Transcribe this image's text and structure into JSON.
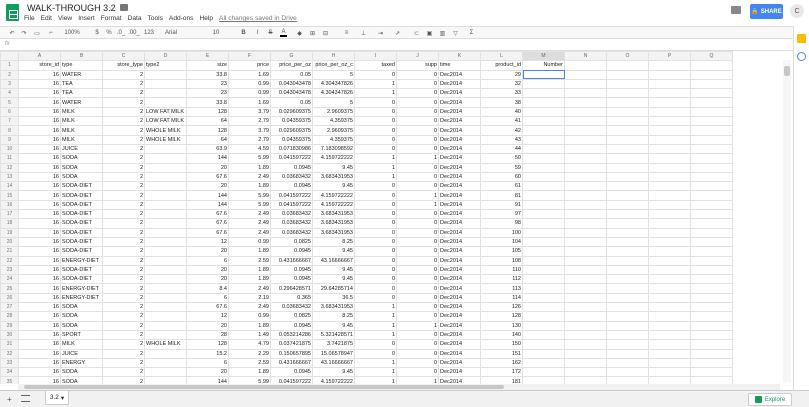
{
  "app": {
    "title": "WALK-THROUGH 3.2",
    "saved_status": "All changes saved in Drive",
    "share_label": "SHARE",
    "avatar_initial": "C"
  },
  "menu": [
    "File",
    "Edit",
    "View",
    "Insert",
    "Format",
    "Data",
    "Tools",
    "Add-ons",
    "Help"
  ],
  "toolbar": {
    "zoom": "100%",
    "currency": "$",
    "percent": "%",
    "decrease_decimals": ".0_",
    "increase_decimals": ".00_",
    "number_format": "123",
    "font": "Arial",
    "font_size": "10"
  },
  "formula_bar": {
    "fx": "fx",
    "value": ""
  },
  "column_letters": [
    "A",
    "B",
    "C",
    "D",
    "E",
    "F",
    "G",
    "H",
    "I",
    "J",
    "K",
    "L",
    "M",
    "N",
    "O",
    "P",
    "Q"
  ],
  "headers": [
    "store_id",
    "type",
    "store_type",
    "type2",
    "size",
    "price",
    "price_per_oz",
    "price_per_oz_c",
    "taxed",
    "supp",
    "time",
    "product_id",
    "Number",
    "",
    "",
    "",
    ""
  ],
  "rows": [
    [
      "16",
      "WATER",
      "2",
      "",
      "33.8",
      "1.69",
      "0.05",
      "5",
      "0",
      "0",
      "Dec2014",
      "29"
    ],
    [
      "16",
      "TEA",
      "2",
      "",
      "23",
      "0.99",
      "0.043043478",
      "4.304347826",
      "1",
      "0",
      "Dec2014",
      "32"
    ],
    [
      "16",
      "TEA",
      "2",
      "",
      "23",
      "0.99",
      "0.043043478",
      "4.304347826",
      "1",
      "0",
      "Dec2014",
      "33"
    ],
    [
      "16",
      "WATER",
      "2",
      "",
      "33.8",
      "1.69",
      "0.05",
      "5",
      "0",
      "0",
      "Dec2014",
      "38"
    ],
    [
      "16",
      "MILK",
      "2",
      "LOW FAT MILK",
      "128",
      "3.79",
      "0.029609375",
      "2.9609375",
      "0",
      "0",
      "Dec2014",
      "40"
    ],
    [
      "16",
      "MILK",
      "2",
      "LOW FAT MILK",
      "64",
      "2.79",
      "0.04359375",
      "4.359375",
      "0",
      "0",
      "Dec2014",
      "41"
    ],
    [
      "16",
      "MILK",
      "2",
      "WHOLE MILK",
      "128",
      "3.79",
      "0.029609375",
      "2.9609375",
      "0",
      "0",
      "Dec2014",
      "42"
    ],
    [
      "16",
      "MILK",
      "2",
      "WHOLE MILK",
      "64",
      "2.79",
      "0.04359375",
      "4.359375",
      "0",
      "0",
      "Dec2014",
      "43"
    ],
    [
      "16",
      "JUICE",
      "2",
      "",
      "63.9",
      "4.59",
      "0.071830986",
      "7.183098592",
      "0",
      "0",
      "Dec2014",
      "44"
    ],
    [
      "16",
      "SODA",
      "2",
      "",
      "144",
      "5.99",
      "0.041597222",
      "4.159722222",
      "1",
      "1",
      "Dec2014",
      "50"
    ],
    [
      "16",
      "SODA",
      "2",
      "",
      "20",
      "1.89",
      "0.0945",
      "9.45",
      "1",
      "0",
      "Dec2014",
      "59"
    ],
    [
      "16",
      "SODA",
      "2",
      "",
      "67.6",
      "2.49",
      "0.03683432",
      "3.683431953",
      "1",
      "0",
      "Dec2014",
      "60"
    ],
    [
      "16",
      "SODA-DIET",
      "2",
      "",
      "20",
      "1.89",
      "0.0945",
      "9.45",
      "0",
      "0",
      "Dec2014",
      "61"
    ],
    [
      "16",
      "SODA-DIET",
      "2",
      "",
      "144",
      "5.99",
      "0.041597222",
      "4.159722222",
      "0",
      "1",
      "Dec2014",
      "81"
    ],
    [
      "16",
      "SODA-DIET",
      "2",
      "",
      "144",
      "5.99",
      "0.041597222",
      "4.159722222",
      "0",
      "1",
      "Dec2014",
      "91"
    ],
    [
      "16",
      "SODA-DIET",
      "2",
      "",
      "67.6",
      "2.49",
      "0.03683432",
      "3.683431953",
      "0",
      "0",
      "Dec2014",
      "97"
    ],
    [
      "16",
      "SODA-DIET",
      "2",
      "",
      "67.6",
      "2.49",
      "0.03683432",
      "3.683431953",
      "0",
      "0",
      "Dec2014",
      "98"
    ],
    [
      "16",
      "SODA-DIET",
      "2",
      "",
      "67.6",
      "2.49",
      "0.03683432",
      "3.683431953",
      "0",
      "0",
      "Dec2014",
      "100"
    ],
    [
      "16",
      "SODA-DIET",
      "2",
      "",
      "12",
      "0.99",
      "0.0825",
      "8.25",
      "0",
      "0",
      "Dec2014",
      "104"
    ],
    [
      "16",
      "SODA-DIET",
      "2",
      "",
      "20",
      "1.89",
      "0.0945",
      "9.45",
      "0",
      "0",
      "Dec2014",
      "105"
    ],
    [
      "16",
      "ENERGY-DIET",
      "2",
      "",
      "6",
      "2.59",
      "0.431666667",
      "43.16666667",
      "0",
      "0",
      "Dec2014",
      "108"
    ],
    [
      "16",
      "SODA-DIET",
      "2",
      "",
      "20",
      "1.89",
      "0.0945",
      "9.45",
      "0",
      "0",
      "Dec2014",
      "110"
    ],
    [
      "16",
      "SODA-DIET",
      "2",
      "",
      "20",
      "1.89",
      "0.0945",
      "9.45",
      "0",
      "0",
      "Dec2014",
      "112"
    ],
    [
      "16",
      "ENERGY-DIET",
      "2",
      "",
      "8.4",
      "2.49",
      "0.296428571",
      "29.64285714",
      "0",
      "0",
      "Dec2014",
      "113"
    ],
    [
      "16",
      "ENERGY-DIET",
      "2",
      "",
      "6",
      "2.19",
      "0.365",
      "36.5",
      "0",
      "0",
      "Dec2014",
      "114"
    ],
    [
      "16",
      "SODA",
      "2",
      "",
      "67.6",
      "2.49",
      "0.03683432",
      "3.683431953",
      "1",
      "0",
      "Dec2014",
      "126"
    ],
    [
      "16",
      "SODA",
      "2",
      "",
      "12",
      "0.99",
      "0.0825",
      "8.25",
      "1",
      "0",
      "Dec2014",
      "128"
    ],
    [
      "16",
      "SODA",
      "2",
      "",
      "20",
      "1.89",
      "0.0945",
      "9.45",
      "1",
      "1",
      "Dec2014",
      "130"
    ],
    [
      "16",
      "SPORT",
      "2",
      "",
      "28",
      "1.49",
      "0.053214286",
      "5.321428571",
      "1",
      "0",
      "Dec2014",
      "140"
    ],
    [
      "16",
      "MILK",
      "2",
      "WHOLE MILK",
      "128",
      "4.79",
      "0.037421875",
      "3.7421875",
      "0",
      "0",
      "Dec2014",
      "150"
    ],
    [
      "16",
      "JUICE",
      "2",
      "",
      "15.2",
      "2.29",
      "0.150657895",
      "15.06578947",
      "0",
      "0",
      "Dec2014",
      "151"
    ],
    [
      "16",
      "ENERGY",
      "2",
      "",
      "6",
      "2.59",
      "0.431666667",
      "43.16666667",
      "1",
      "0",
      "Dec2014",
      "162"
    ],
    [
      "16",
      "SODA",
      "2",
      "",
      "20",
      "1.89",
      "0.0945",
      "9.45",
      "1",
      "0",
      "Dec2014",
      "172"
    ],
    [
      "16",
      "SODA",
      "2",
      "",
      "144",
      "5.99",
      "0.041597222",
      "4.159722222",
      "1",
      "1",
      "Dec2014",
      "181"
    ]
  ],
  "sheet_tab": "3.2",
  "explore_label": "Explore"
}
